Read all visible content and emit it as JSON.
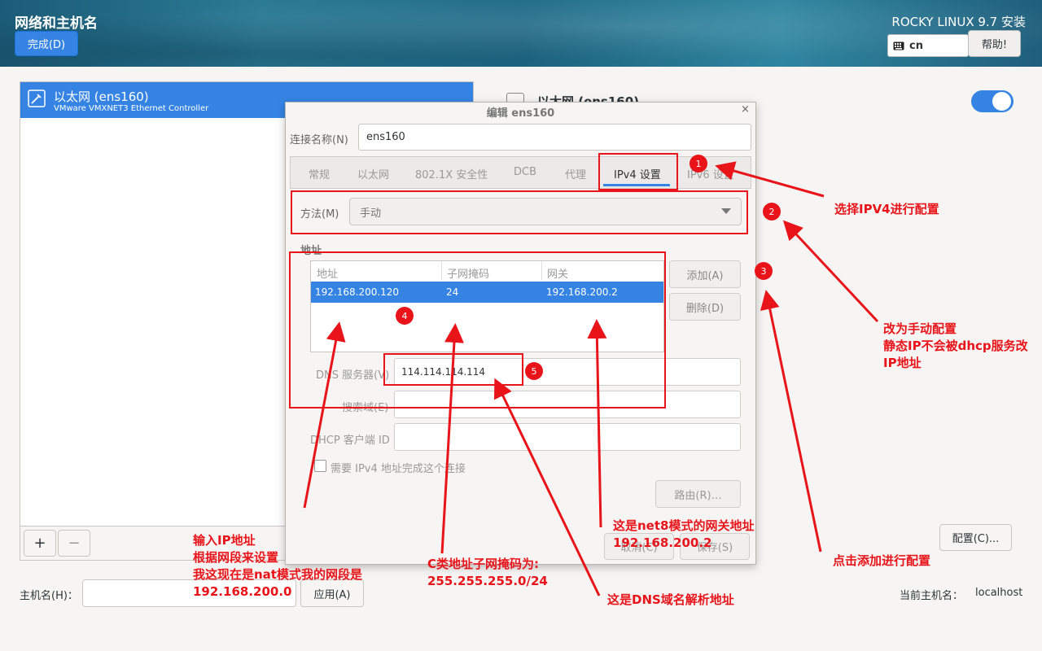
{
  "header": {
    "title": "网络和主机名",
    "done_label": "完成(D)",
    "distro": "ROCKY LINUX 9.7 安装",
    "keyboard_layout": "cn",
    "help_label": "帮助!"
  },
  "devices": [
    {
      "name": "以太网 (ens160)",
      "description": "VMware VMXNET3 Ethernet Controller"
    }
  ],
  "list_footer": {
    "add_label": "+",
    "remove_label": "−"
  },
  "hostname": {
    "label": "主机名(H)：",
    "value": "",
    "apply_label": "应用(A)",
    "current_label": "当前主机名：",
    "current_value": "localhost"
  },
  "right_panel": {
    "device_title": "以太网 (ens160)",
    "toggle_on": true,
    "config_label": "配置(C)..."
  },
  "dialog": {
    "title": "编辑 ens160",
    "close": "×",
    "connection_name_label": "连接名称(N)",
    "connection_name_value": "ens160",
    "tabs": [
      "常规",
      "以太网",
      "802.1X 安全性",
      "DCB",
      "代理",
      "IPv4 设置",
      "IPv6 设置"
    ],
    "active_tab": "IPv4 设置",
    "method_label": "方法(M)",
    "method_value": "手动",
    "addresses_label": "地址",
    "columns": [
      "地址",
      "子网掩码",
      "网关"
    ],
    "rows": [
      [
        "192.168.200.120",
        "24",
        "192.168.200.2"
      ]
    ],
    "add_label": "添加(A)",
    "delete_label": "删除(D)",
    "dns_label": "DNS 服务器(V)",
    "dns_value": "114.114.114.114",
    "search_label": "搜索域(E)",
    "dhcp_label": "DHCP 客户端 ID",
    "require_label": "需要 IPv4 地址完成这个连接",
    "routes_label": "路由(R)…",
    "cancel_label": "取消(C)",
    "save_label": "保存(S)"
  },
  "annotations": {
    "badges": [
      "1",
      "2",
      "3",
      "4",
      "5"
    ],
    "note1": "选择IPV4进行配置",
    "note2": [
      "改为手动配置",
      "静态IP不会被dhcp服务改",
      "IP地址"
    ],
    "note3": "点击添加进行配置",
    "note4": [
      "输入IP地址",
      "根据网段来设置",
      "我这现在是nat模式我的网段是",
      "192.168.200.0"
    ],
    "note5": [
      "C类地址子网掩码为:",
      "255.255.255.0/24"
    ],
    "note6": [
      "这是net8模式的网关地址",
      "192.168.200.2"
    ],
    "note7": "这是DNS域名解析地址",
    "color": "#e8141a"
  }
}
